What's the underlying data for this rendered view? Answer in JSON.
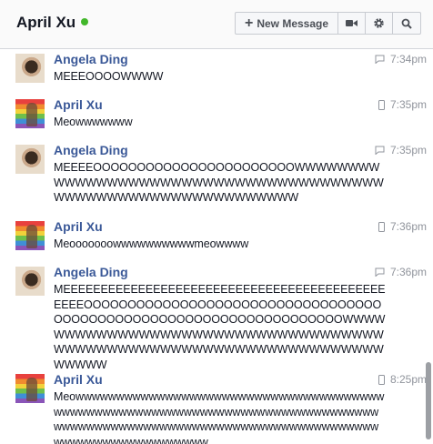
{
  "header": {
    "title": "April Xu",
    "new_message_label": "New Message",
    "video_icon": "video-camera-icon",
    "settings_icon": "gear-icon",
    "search_icon": "search-icon",
    "online_color": "#42b72a"
  },
  "messages": [
    {
      "sender": "Angela Ding",
      "time": "7:34pm",
      "device": "chat-icon",
      "text": "MEEEOOOOWWWW"
    },
    {
      "sender": "April Xu",
      "time": "7:35pm",
      "device": "mobile-icon",
      "text": "Meowwwwwww"
    },
    {
      "sender": "Angela Ding",
      "time": "7:35pm",
      "device": "chat-icon",
      "text": "MEEEEOOOOOOOOOOOOOOOOOOOOOOOWWWWWWWWWWWWWWWWWWWWWWWWWWWWWWWWWWWWWWWWWWWWWWWWWWWWWWWWWWWWWW"
    },
    {
      "sender": "April Xu",
      "time": "7:36pm",
      "device": "mobile-icon",
      "text": "Meooooooowwwwwwwwwwmeowwww"
    },
    {
      "sender": "Angela Ding",
      "time": "7:36pm",
      "device": "chat-icon",
      "text": "MEEEEEEEEEEEEEEEEEEEEEEEEEEEEEEEEEEEEEEEEEEEEEEEOOOOOOOOOOOOOOOOOOOOOOOOOOOOOOOOOOOOOOOOOOOOOOOOOOOOOOOOOOOOOOOOOOOWWWWWWWWWWWWWWWWWWWWWWWWWWWWWWWWWWWWWWWWWWWWWWWWWWWWWWWWWWWWWWWWWWWWWWW"
    },
    {
      "sender": "April Xu",
      "time": "8:25pm",
      "device": "mobile-icon",
      "text": "Meowwwwwwwwwwwwwwwwwwwwwwwwwwwwwwwwwwwwwwwwwwwwwwwwwwwwwwwwwwwwwwwwwwwwwwwwwwwwwwwwwwwwwwwwwwwwwwwwwwwwwwwwwwwwwwwwwwwwwwwwwwwwwwwwwwwwwwwww"
    }
  ]
}
